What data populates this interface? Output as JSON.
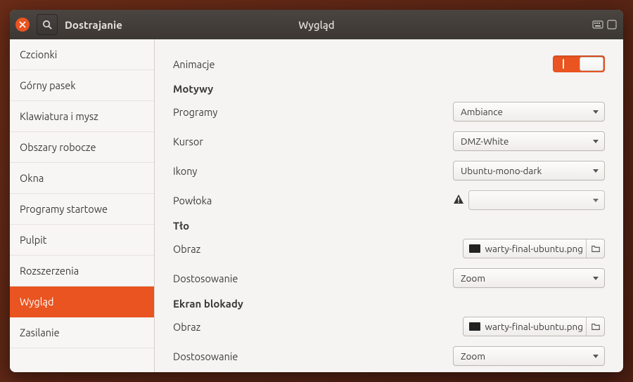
{
  "app_title": "Dostrajanie",
  "page_title": "Wygląd",
  "sidebar": {
    "items": [
      {
        "label": "Czcionki"
      },
      {
        "label": "Górny pasek"
      },
      {
        "label": "Klawiatura i mysz"
      },
      {
        "label": "Obszary robocze"
      },
      {
        "label": "Okna"
      },
      {
        "label": "Programy startowe"
      },
      {
        "label": "Pulpit"
      },
      {
        "label": "Rozszerzenia"
      },
      {
        "label": "Wygląd"
      },
      {
        "label": "Zasilanie"
      }
    ],
    "selected_index": 8
  },
  "content": {
    "animations_label": "Animacje",
    "animations_on": true,
    "section_themes": "Motywy",
    "programs_label": "Programy",
    "programs_value": "Ambiance",
    "cursor_label": "Kursor",
    "cursor_value": "DMZ-White",
    "icons_label": "Ikony",
    "icons_value": "Ubuntu-mono-dark",
    "shell_label": "Powłoka",
    "shell_value": "",
    "shell_warning": true,
    "section_background": "Tło",
    "bg_image_label": "Obraz",
    "bg_image_value": "warty-final-ubuntu.png",
    "bg_fit_label": "Dostosowanie",
    "bg_fit_value": "Zoom",
    "section_lock": "Ekran blokady",
    "lock_image_label": "Obraz",
    "lock_image_value": "warty-final-ubuntu.png",
    "lock_fit_label": "Dostosowanie",
    "lock_fit_value": "Zoom"
  },
  "colors": {
    "accent": "#e95420"
  }
}
